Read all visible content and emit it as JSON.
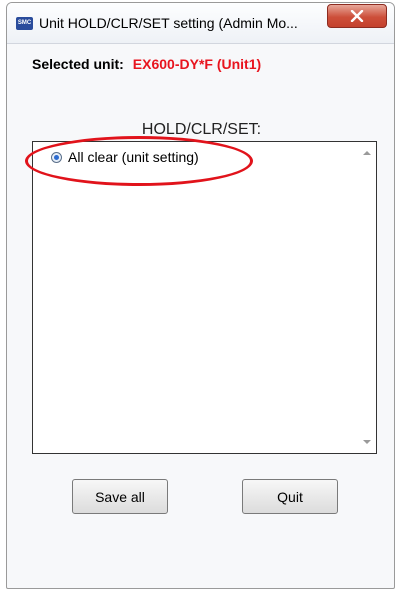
{
  "window": {
    "title": "Unit HOLD/CLR/SET setting (Admin Mo...",
    "app_icon": "smc-app-icon",
    "close_icon": "close-icon"
  },
  "selected_unit": {
    "label": "Selected unit:",
    "value": "EX600-DY*F (Unit1)"
  },
  "group": {
    "title": "HOLD/CLR/SET:"
  },
  "options": [
    {
      "label": "All clear (unit setting)",
      "selected": true
    }
  ],
  "buttons": {
    "save_all": "Save all",
    "quit": "Quit"
  },
  "colors": {
    "selected_value": "#e8141e",
    "annotation": "#e1131b",
    "close_button": "#cd4f3a"
  }
}
